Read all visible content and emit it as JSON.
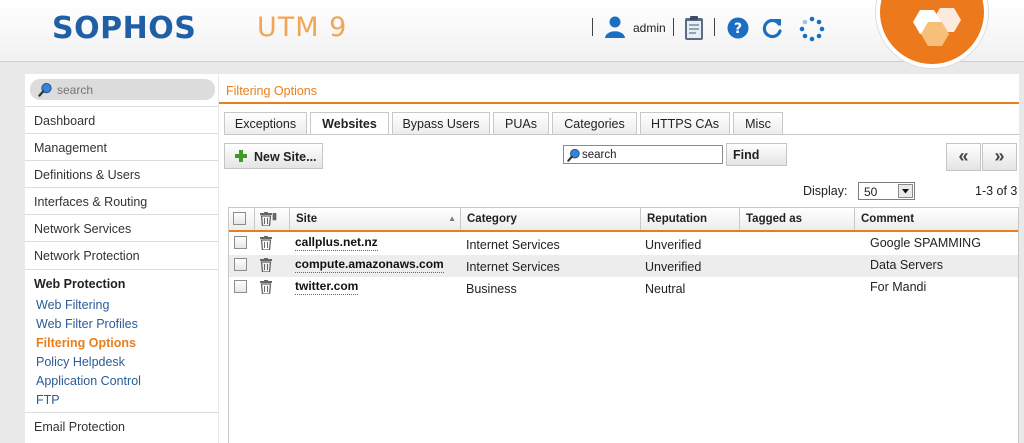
{
  "header": {
    "logo": "SOPHOS",
    "product": "UTM 9",
    "user": "admin",
    "icons": [
      "user-icon",
      "clipboard-icon",
      "help-icon",
      "reload-icon",
      "spinner-icon",
      "badge-hexagon-icon"
    ],
    "accent_color": "#ec7a1c",
    "brand_color": "#1f5fa6"
  },
  "sidebar": {
    "search_placeholder": "search",
    "items": [
      {
        "label": "Dashboard"
      },
      {
        "label": "Management"
      },
      {
        "label": "Definitions & Users"
      },
      {
        "label": "Interfaces & Routing"
      },
      {
        "label": "Network Services"
      },
      {
        "label": "Network Protection"
      },
      {
        "label": "Web Protection"
      },
      {
        "label": "Email Protection"
      }
    ],
    "subitems": [
      {
        "label": "Web Filtering"
      },
      {
        "label": "Web Filter Profiles"
      },
      {
        "label": "Filtering Options"
      },
      {
        "label": "Policy Helpdesk"
      },
      {
        "label": "Application Control"
      },
      {
        "label": "FTP"
      }
    ]
  },
  "main": {
    "title": "Filtering Options",
    "tabs": [
      {
        "label": "Exceptions"
      },
      {
        "label": "Websites"
      },
      {
        "label": "Bypass Users"
      },
      {
        "label": "PUAs"
      },
      {
        "label": "Categories"
      },
      {
        "label": "HTTPS CAs"
      },
      {
        "label": "Misc"
      }
    ],
    "active_tab": "Websites",
    "new_button": "New Site...",
    "search_value": "search",
    "find_button": "Find",
    "pager": {
      "prev": "«",
      "next": "»"
    },
    "display_label": "Display:",
    "display_value": "50",
    "count": "1-3 of 3"
  },
  "table": {
    "columns": [
      "Site",
      "Category",
      "Reputation",
      "Tagged as",
      "Comment"
    ],
    "rows": [
      {
        "site": "callplus.net.nz",
        "category": "Internet Services",
        "reputation": "Unverified",
        "tagged": "",
        "comment": "Google SPAMMING"
      },
      {
        "site": "compute.amazonaws.com",
        "category": "Internet Services",
        "reputation": "Unverified",
        "tagged": "",
        "comment": "Data Servers"
      },
      {
        "site": "twitter.com",
        "category": "Business",
        "reputation": "Neutral",
        "tagged": "",
        "comment": "For Mandi"
      }
    ]
  }
}
